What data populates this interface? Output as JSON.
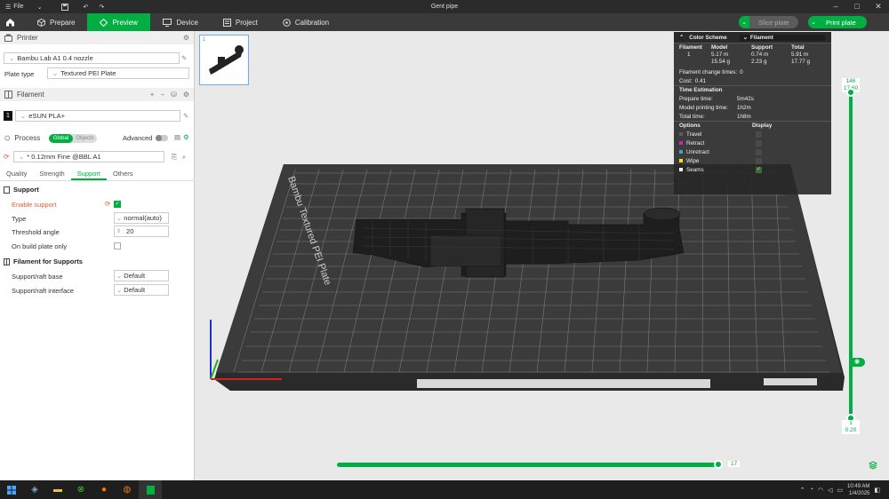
{
  "window": {
    "title": "Gent pipe",
    "menu_file": "File"
  },
  "toolbar": {
    "tabs": [
      {
        "label": "Prepare"
      },
      {
        "label": "Preview"
      },
      {
        "label": "Device"
      },
      {
        "label": "Project"
      },
      {
        "label": "Calibration"
      }
    ],
    "active_tab": "Preview",
    "slice_label": "Slice plate",
    "print_label": "Print plate"
  },
  "sidebar": {
    "printer_title": "Printer",
    "printer_value": "Bambu Lab A1 0.4 nozzle",
    "plate_type_label": "Plate type",
    "plate_type_value": "Textured PEI Plate",
    "filament_title": "Filament",
    "filament_index": "1",
    "filament_value": "eSUN PLA+",
    "process_title": "Process",
    "process_global": "Global",
    "process_objects": "Objects",
    "advanced_label": "Advanced",
    "process_value": "* 0.12mm Fine @BBL A1",
    "tabs": [
      "Quality",
      "Strength",
      "Support",
      "Others"
    ],
    "active_tab": "Support",
    "support_title": "Support",
    "enable_support_label": "Enable support",
    "type_label": "Type",
    "type_value": "normal(auto)",
    "threshold_label": "Threshold angle",
    "threshold_value": "20",
    "build_plate_only_label": "On build plate only",
    "filament_supports_title": "Filament for Supports",
    "raft_base_label": "Support/raft base",
    "raft_base_value": "Default",
    "raft_interface_label": "Support/raft interface",
    "raft_interface_value": "Default"
  },
  "viewport": {
    "plate_number": "1",
    "plate_label": "Bambu Textured PEI Plate",
    "layer_top": "146",
    "layer_top_height": "17.60",
    "layer_bottom": "1",
    "layer_bottom_height": "0.20",
    "move_value": "17"
  },
  "stats": {
    "color_scheme_label": "Color Scheme",
    "color_scheme_value": "Filament",
    "headers": [
      "Filament",
      "Model",
      "Support",
      "Total"
    ],
    "row": {
      "index": "1",
      "model_m": "5.17 m",
      "model_g": "15.54 g",
      "support_m": "0.74 m",
      "support_g": "2.23 g",
      "total_m": "5.91 m",
      "total_g": "17.77 g"
    },
    "filament_change_label": "Filament change times:",
    "filament_change_value": "0",
    "cost_label": "Cost:",
    "cost_value": "0.41",
    "time_title": "Time Estimation",
    "prepare_label": "Prepare time:",
    "prepare_value": "5m42s",
    "model_time_label": "Model printing time:",
    "model_time_value": "1h2m",
    "total_time_label": "Total time:",
    "total_time_value": "1h8m",
    "options_label": "Options",
    "display_label": "Display",
    "options": [
      {
        "label": "Travel",
        "color": "#5a5a5a"
      },
      {
        "label": "Retract",
        "color": "#d020c0"
      },
      {
        "label": "Unretract",
        "color": "#40a0d0"
      },
      {
        "label": "Wipe",
        "color": "#f0e020"
      },
      {
        "label": "Seams",
        "color": "#f0f0f0"
      }
    ]
  },
  "taskbar": {
    "time": "10:49 AM",
    "date": "1/4/2025"
  },
  "colors": {
    "accent": "#00ae42"
  }
}
